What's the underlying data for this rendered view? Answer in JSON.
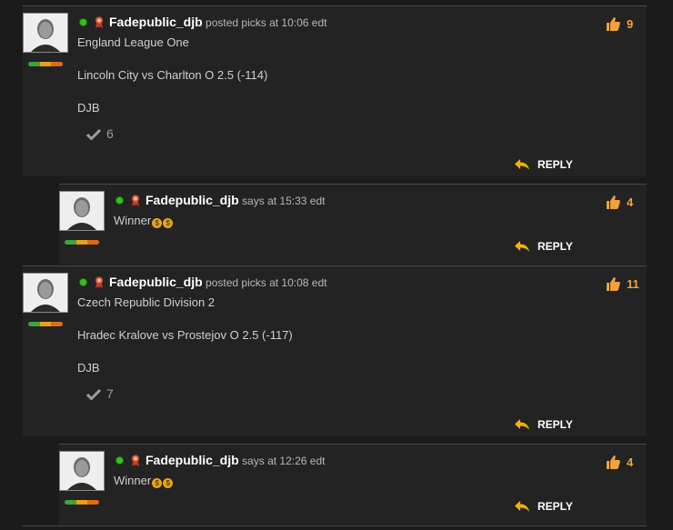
{
  "posts": [
    {
      "username": "Fadepublic_djb",
      "action": "posted picks",
      "time": "at 10:06 edt",
      "league": "England League One",
      "pick": "Lincoln City vs Charlton O 2.5 (-114)",
      "signature": "DJB",
      "agree_count": "6",
      "likes": "9",
      "reply_label": "REPLY",
      "reply": {
        "username": "Fadepublic_djb",
        "action": "says",
        "time": "at 15:33 edt",
        "text": "Winner",
        "likes": "4",
        "reply_label": "REPLY"
      }
    },
    {
      "username": "Fadepublic_djb",
      "action": "posted picks",
      "time": "at 10:08 edt",
      "league": "Czech Republic Division 2",
      "pick": "Hradec Kralove vs Prostejov O 2.5 (-117)",
      "signature": "DJB",
      "agree_count": "7",
      "likes": "11",
      "reply_label": "REPLY",
      "reply": {
        "username": "Fadepublic_djb",
        "action": "says",
        "time": "at 12:26 edt",
        "text": "Winner",
        "likes": "4",
        "reply_label": "REPLY"
      }
    }
  ],
  "icons": {
    "online": "online-status-dot-icon",
    "badge": "ribbon-badge-icon",
    "like": "thumbs-up-icon",
    "agree": "checkmark-icon",
    "reply": "reply-arrow-icon",
    "coin": "money-bag-icon"
  },
  "colors": {
    "username": "#ffffff",
    "likes": "#f0a23c",
    "online": "#35c21f",
    "reply_arrow": "#f2b200"
  }
}
